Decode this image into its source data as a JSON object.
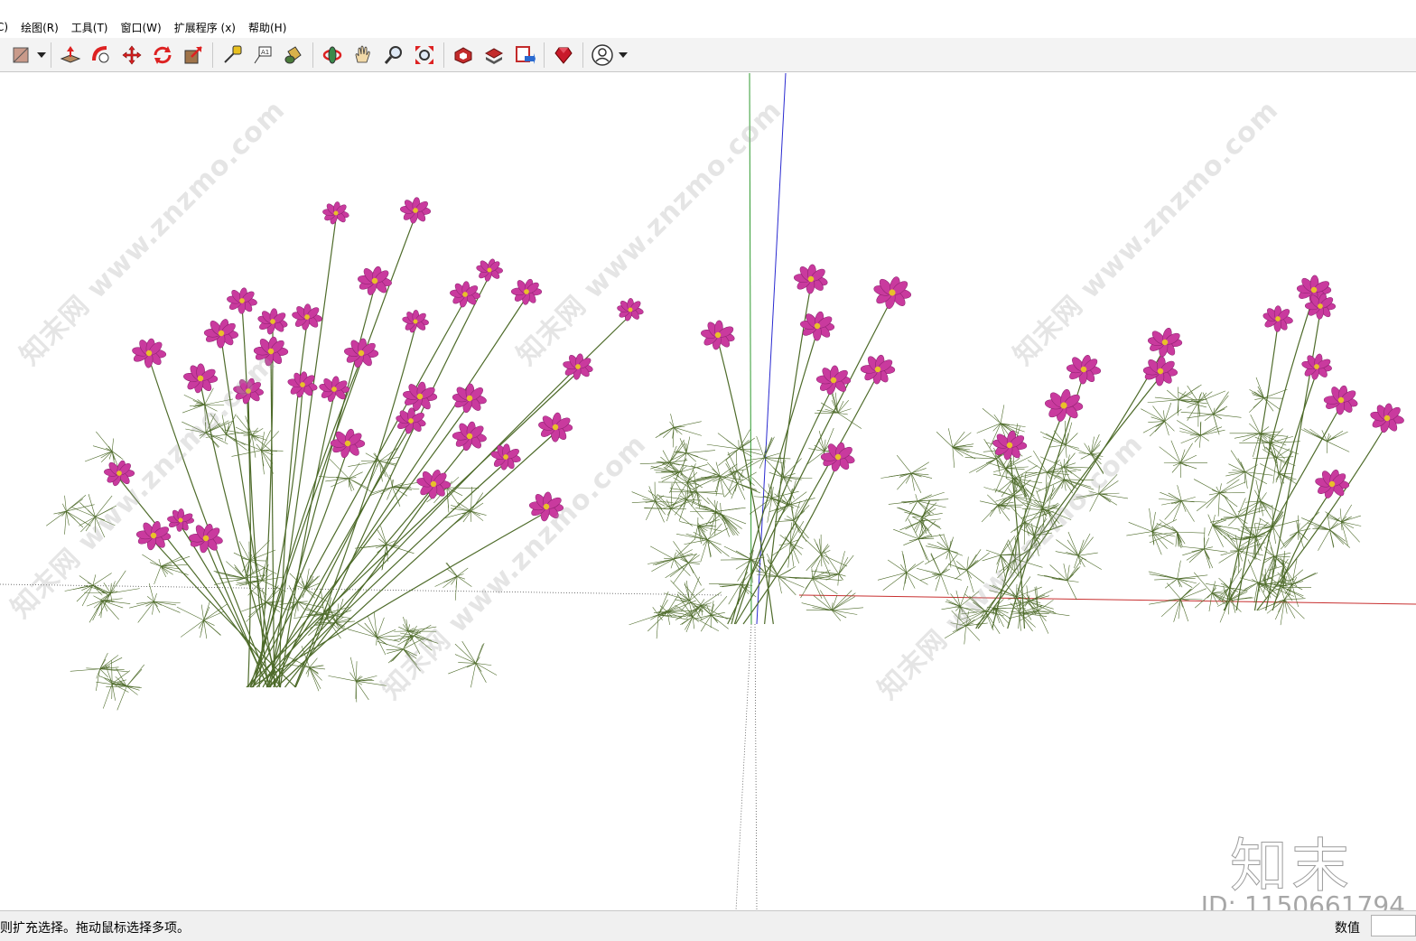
{
  "menu": {
    "items": [
      {
        "label": "C)"
      },
      {
        "label": "绘图(R)"
      },
      {
        "label": "工具(T)"
      },
      {
        "label": "窗口(W)"
      },
      {
        "label": "扩展程序 (x)"
      },
      {
        "label": "帮助(H)"
      }
    ]
  },
  "toolbar": {
    "icons": [
      "eraser-icon",
      "dropdown-caret-icon",
      "push-pull-icon",
      "follow-me-icon",
      "move-icon",
      "rotate-icon",
      "scale-icon",
      "tape-measure-icon",
      "text-label-icon",
      "paint-bucket-icon",
      "orbit-icon",
      "pan-icon",
      "zoom-icon",
      "zoom-extents-icon",
      "3d-warehouse-icon",
      "extension-warehouse-icon",
      "layout-send-icon",
      "ruby-console-icon",
      "account-icon",
      "account-dropdown-icon"
    ]
  },
  "viewport": {
    "axis_colors": {
      "green": "#2f9a2f",
      "blue": "#2a2ad0",
      "red": "#c83030"
    },
    "flower_color": "#c93a9e",
    "flower_center": "#e8c02a",
    "foliage_color": "#4e6b2a",
    "watermark_text": "知末网 www.znzmo.com",
    "watermark_logo": "知末",
    "watermark_id": "ID: 1150661794"
  },
  "statusbar": {
    "hint": "则扩充选择。拖动鼠标选择多项。",
    "measurements_label": "数值",
    "measurements_value": ""
  }
}
